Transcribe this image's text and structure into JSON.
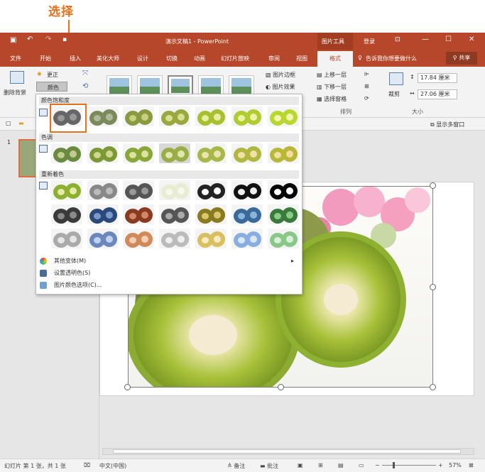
{
  "annotation": {
    "label": "选择"
  },
  "titlebar": {
    "title": "演示文稿1 - PowerPoint",
    "picture_tools": "图片工具",
    "login": "登录"
  },
  "tabs": [
    "文件",
    "开始",
    "插入",
    "美化大师",
    "设计",
    "切换",
    "动画",
    "幻灯片放映",
    "审阅",
    "视图",
    "格式"
  ],
  "tell_me": "告诉我你想要做什么",
  "share": "共享",
  "ribbon": {
    "remove_bg": "删除背景",
    "corrections": "更正",
    "color": "颜色",
    "picture_border": "图片边框",
    "picture_effects": "图片效果",
    "bring_forward": "上移一层",
    "send_backward": "下移一层",
    "selection_pane": "选择窗格",
    "arrange_label": "排列",
    "crop": "裁剪",
    "height": "17.84 厘米",
    "width": "27.06 厘米",
    "size_label": "大小",
    "show_multi": "显示多窗口"
  },
  "thumbs": {
    "slide_number": "1"
  },
  "dropdown": {
    "saturation": "颜色饱和度",
    "tone": "色调",
    "recolor": "重新着色",
    "more_variations": "其他变体(M)",
    "set_transparent": "设置透明色(S)",
    "picture_color_options": "图片颜色选项(C)..."
  },
  "status": {
    "slide_info": "幻灯片 第 1 张，共 1 张",
    "language": "中文(中国)",
    "notes": "备注",
    "comments": "批注",
    "zoom": "57%"
  },
  "colors": {
    "accent": "#b7472a",
    "highlight": "#e8711c"
  }
}
